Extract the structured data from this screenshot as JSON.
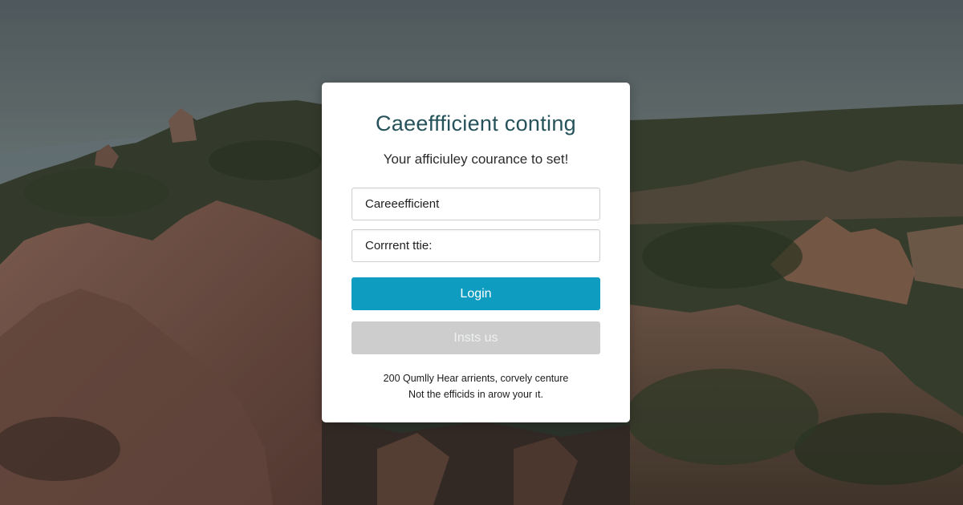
{
  "login_card": {
    "title": "Caeeffficient conting",
    "subtitle": "Your afficiuley courance to set!",
    "fields": {
      "username_value": "Careeefficient",
      "password_value": "Corrrent ttie:"
    },
    "login_button_label": "Login",
    "secondary_button_label": "Insts us",
    "footer_line_1": "200 Qumlly Hear arrients, corvely centure",
    "footer_line_2": "Not the efficids in arow your ıt."
  },
  "colors": {
    "title": "#26535b",
    "login_button": "#0f9cc1",
    "secondary_button": "#cdcdcd"
  }
}
